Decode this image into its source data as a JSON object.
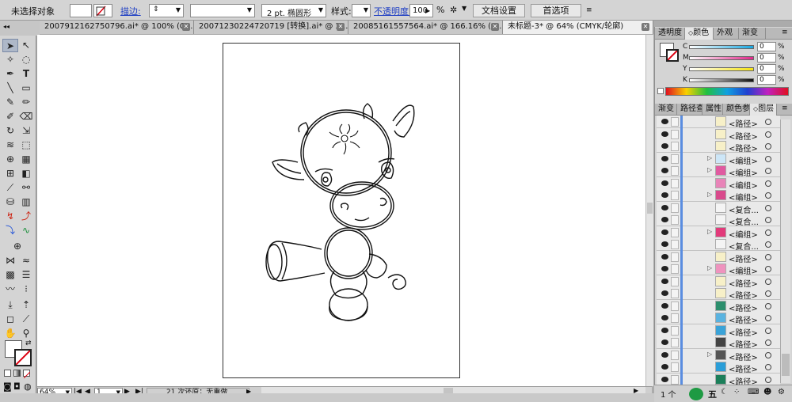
{
  "control_bar": {
    "selection_label": "未选择对象",
    "stroke_label": "描边:",
    "brush_label": "2 pt. 椭圆形",
    "style_label": "样式:",
    "opacity_label": "不透明度:",
    "opacity_value": "100",
    "opacity_unit": "%",
    "doc_setup_button": "文档设置",
    "prefs_button": "首选项"
  },
  "document_tabs": [
    {
      "label": "20079121627507​96.ai* @ 100% (C..."
    },
    {
      "label": "20071230224720719 [转换].ai* @ 2..."
    },
    {
      "label": "20085161557564.ai* @ 166.16% (C..."
    },
    {
      "label": "未标题-3* @ 64% (CMYK/轮廓)"
    }
  ],
  "color_panel": {
    "tabs": [
      "透明度",
      "颜色",
      "外观",
      "渐变"
    ],
    "channels": [
      {
        "label": "C",
        "value": "0",
        "color": "#19a7e0"
      },
      {
        "label": "M",
        "value": "0",
        "color": "#e0278a"
      },
      {
        "label": "Y",
        "value": "0",
        "color": "#f5e413"
      },
      {
        "label": "K",
        "value": "0",
        "color": "#111111"
      }
    ],
    "percent": "%"
  },
  "layers_panel": {
    "tabs": [
      "渐变",
      "路径查",
      "属性",
      "颜色参",
      "图层"
    ],
    "rows": [
      {
        "name": "<路径>",
        "expand": false,
        "thumb": "#f7f0c8"
      },
      {
        "name": "<路径>",
        "expand": false,
        "thumb": "#f7f0c8"
      },
      {
        "name": "<路径>",
        "expand": false,
        "thumb": "#f7f0c8"
      },
      {
        "name": "<编组>",
        "expand": true,
        "thumb": "#cde6f7"
      },
      {
        "name": "<编组>",
        "expand": true,
        "thumb": "#e05aa0"
      },
      {
        "name": "<编组>",
        "expand": false,
        "thumb": "#e884b8"
      },
      {
        "name": "<编组>",
        "expand": true,
        "thumb": "#d94a8c"
      },
      {
        "name": "<复合...",
        "expand": false,
        "thumb": "#f4f4f4"
      },
      {
        "name": "<复合...",
        "expand": false,
        "thumb": "#f4f4f4"
      },
      {
        "name": "<编组>",
        "expand": true,
        "thumb": "#e23a7a"
      },
      {
        "name": "<复合...",
        "expand": false,
        "thumb": "#f4f4f4"
      },
      {
        "name": "<路径>",
        "expand": false,
        "thumb": "#f7f0c8"
      },
      {
        "name": "<编组>",
        "expand": true,
        "thumb": "#ef93be"
      },
      {
        "name": "<路径>",
        "expand": false,
        "thumb": "#f7f0c8"
      },
      {
        "name": "<路径>",
        "expand": false,
        "thumb": "#f7f0c8"
      },
      {
        "name": "<路径>",
        "expand": false,
        "thumb": "#2c8f6d"
      },
      {
        "name": "<路径>",
        "expand": false,
        "thumb": "#5ab3e0"
      },
      {
        "name": "<路径>",
        "expand": false,
        "thumb": "#3aa3d8"
      },
      {
        "name": "<路径>",
        "expand": false,
        "thumb": "#444444"
      },
      {
        "name": "<路径>",
        "expand": true,
        "thumb": "#555555"
      },
      {
        "name": "<路径>",
        "expand": false,
        "thumb": "#2a9ed8"
      },
      {
        "name": "<路径>",
        "expand": false,
        "thumb": "#1c7f5a"
      }
    ],
    "footer_count": "1 个"
  },
  "status_bar": {
    "zoom": "64%",
    "page": "1",
    "undo_info": "21 次还原；无重做"
  },
  "taskbar": {
    "ime_label": "五"
  },
  "colors": {
    "panel_bg": "#d4d4d4",
    "canvas": "#ffffff",
    "link_blue": "#1f3fc4"
  }
}
